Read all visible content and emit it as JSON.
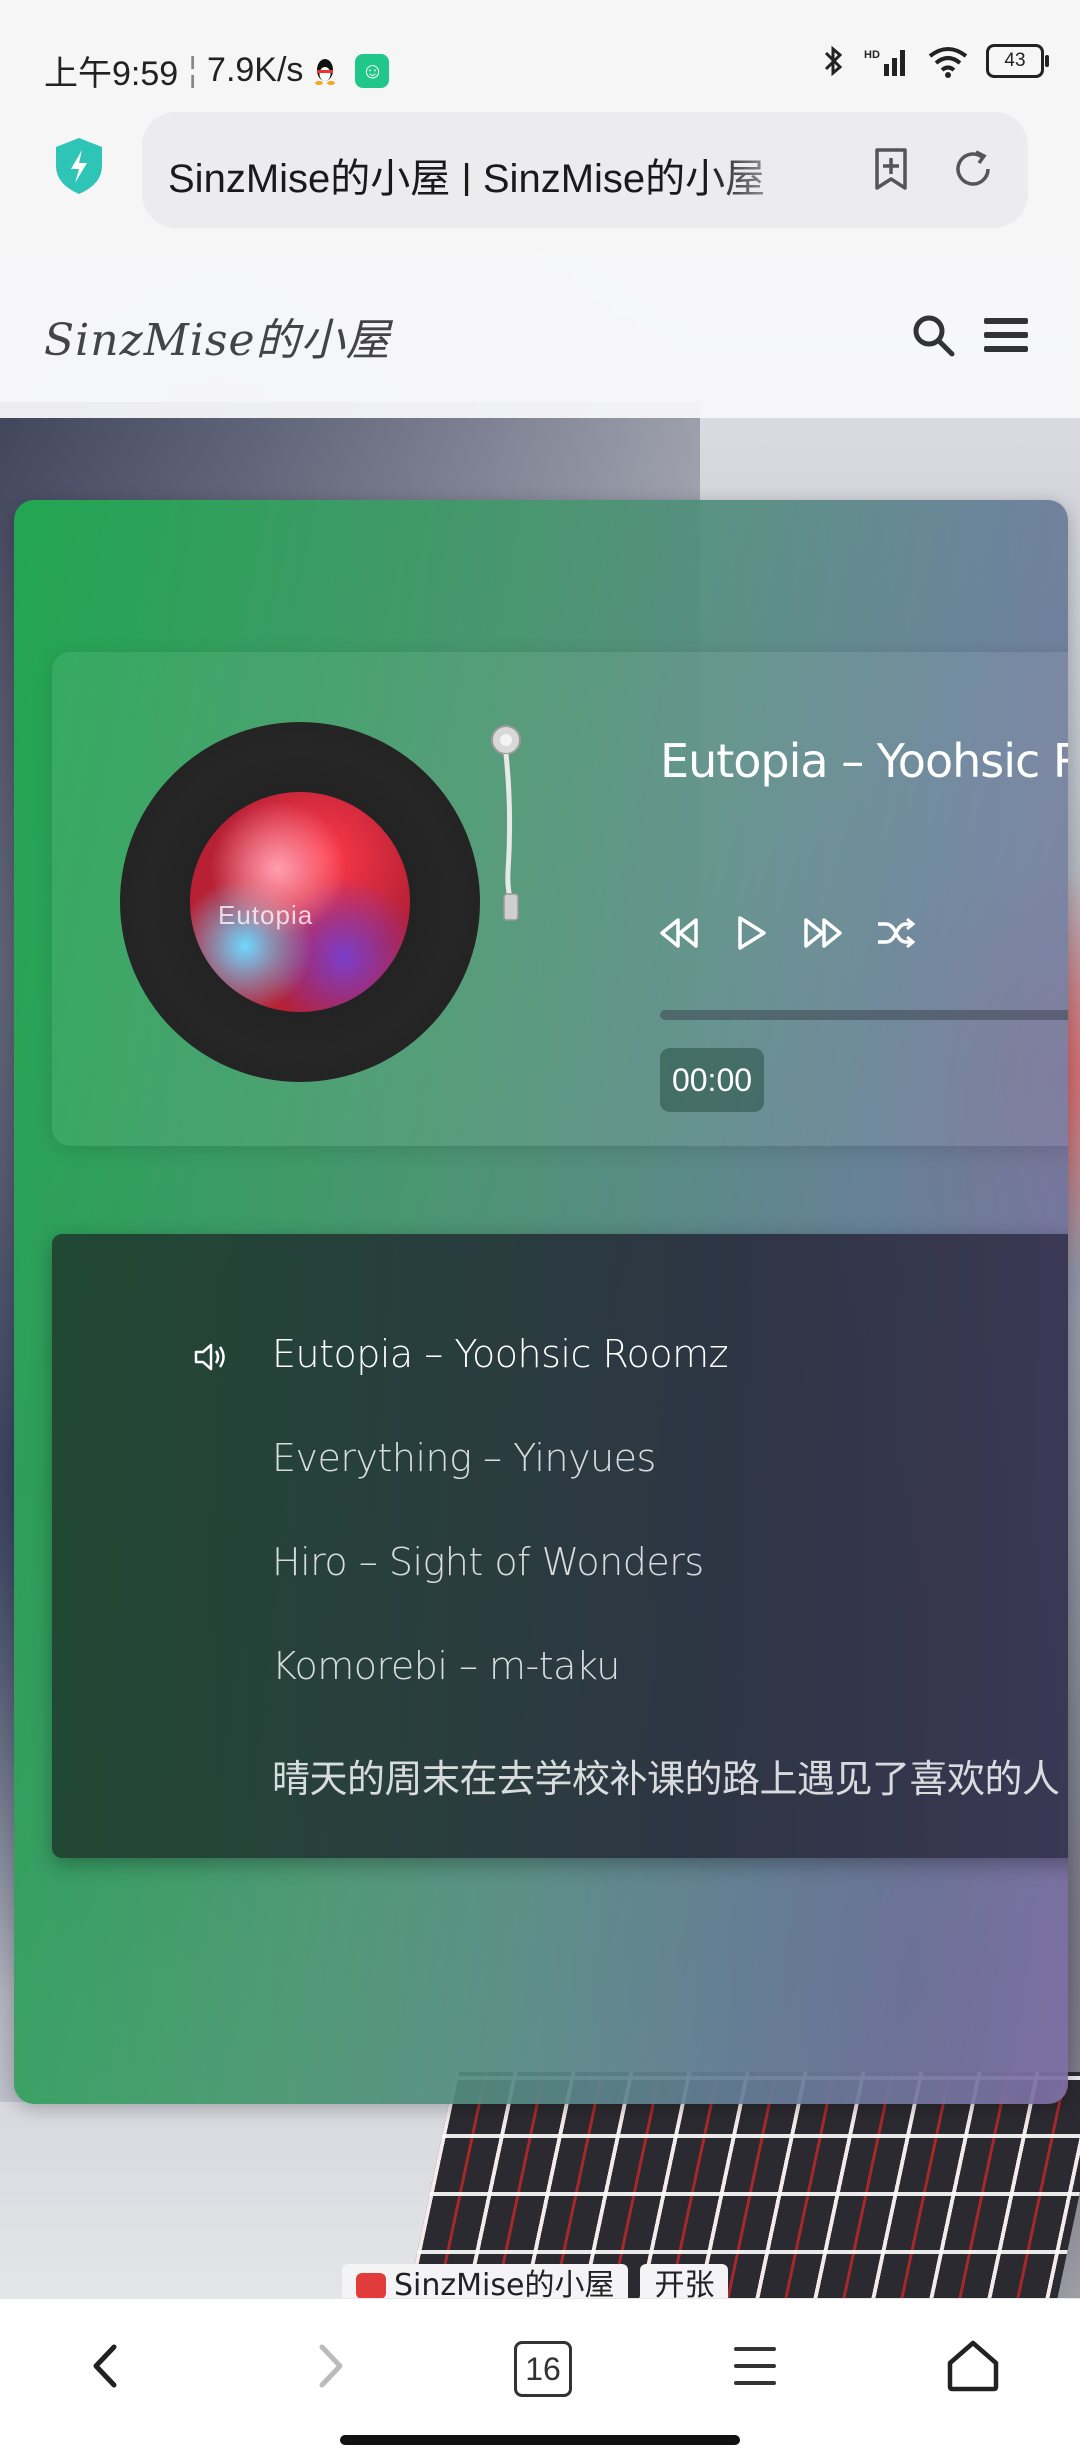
{
  "status_bar": {
    "time": "上午9:59",
    "network_speed": "7.9K/s",
    "battery": "43"
  },
  "browser": {
    "url_title": "SinzMise的小屋 | SinzMise的小屋",
    "tab_count": "16"
  },
  "site": {
    "title": "SinzMise的小屋"
  },
  "player": {
    "now_playing_title": "Eutopia – Yoohsic Roomz",
    "cover_text": "Eutopia",
    "current_time": "00:00",
    "progress": 0.0,
    "playlist": [
      {
        "label": "Eutopia – Yoohsic Roomz",
        "active": true
      },
      {
        "label": "Everything – Yinyues",
        "active": false
      },
      {
        "label": "Hiro – Sight of Wonders",
        "active": false
      },
      {
        "label": "Komorebi – m-taku",
        "active": false
      },
      {
        "label": "晴天的周末在去学校补课的路上遇见了喜欢的人",
        "active": false
      }
    ]
  },
  "bottom_chips": {
    "chip1": "SinzMise的小屋",
    "chip2": "开张"
  },
  "colors": {
    "player_green": "#20aa50",
    "player_purple": "#7e6ea5",
    "status_app_green": "#21c78a",
    "shield_teal": "#2ec4b6"
  }
}
